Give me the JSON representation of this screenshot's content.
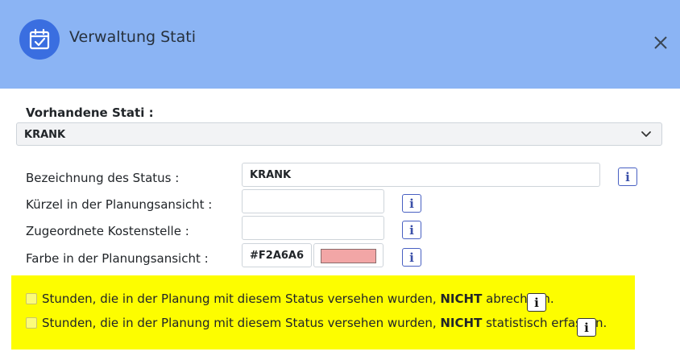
{
  "dialog": {
    "title": "Verwaltung Stati",
    "icon": "calendar-check-icon",
    "close_icon": "close-icon",
    "header_color": "#8bb4f4"
  },
  "existing": {
    "label": "Vorhandene Stati :",
    "selected": "KRANK"
  },
  "form": {
    "name_label": "Bezeichnung des Status :",
    "name_value": "KRANK",
    "short_label": "Kürzel in der Planungsansicht :",
    "short_value": "",
    "cost_label": "Zugeordnete Kostenstelle :",
    "cost_value": "",
    "color_label": "Farbe in der Planungsansicht :",
    "color_value": "#F2A6A6",
    "info_glyph": "i"
  },
  "options": {
    "no_billing": {
      "text_before": "Stunden, die in der Planung mit diesem Status versehen wurden, ",
      "text_bold": "NICHT",
      "text_after": " abrechnen.",
      "checked": false
    },
    "no_stats": {
      "text_before": "Stunden, die in der Planung mit diesem Status versehen wurden, ",
      "text_bold": "NICHT",
      "text_after": " statistisch erfassen.",
      "checked": false
    },
    "panel_color": "#fdfd00"
  }
}
